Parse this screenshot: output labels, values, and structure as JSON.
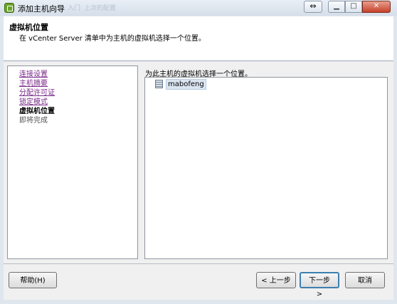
{
  "window": {
    "title": "添加主机向导",
    "ghost_tab_1": "入门",
    "ghost_tab_2": "上次的配置",
    "move_glyph": "⇔",
    "minimize_glyph": "▁",
    "maximize_glyph": "□",
    "close_glyph": "✕"
  },
  "header": {
    "title": "虚拟机位置",
    "subtitle": "在 vCenter Server 清单中为主机的虚拟机选择一个位置。"
  },
  "nav": {
    "items": [
      {
        "label": "连接设置",
        "state": "link"
      },
      {
        "label": "主机摘要",
        "state": "link"
      },
      {
        "label": "分配许可证",
        "state": "link"
      },
      {
        "label": "锁定模式",
        "state": "link"
      },
      {
        "label": "虚拟机位置",
        "state": "current"
      },
      {
        "label": "即将完成",
        "state": "pending"
      }
    ]
  },
  "content": {
    "prompt": "为此主机的虚拟机选择一个位置。",
    "tree": [
      {
        "label": "mabofeng",
        "icon": "datacenter-icon",
        "selected": true
      }
    ]
  },
  "footer": {
    "help": "帮助(H)",
    "back": "< 上一步",
    "next": "下一步 >",
    "cancel": "取消"
  },
  "colors": {
    "link": "#7a2a8a",
    "selection": "#dbe5f1",
    "close_button": "#c7412a"
  }
}
